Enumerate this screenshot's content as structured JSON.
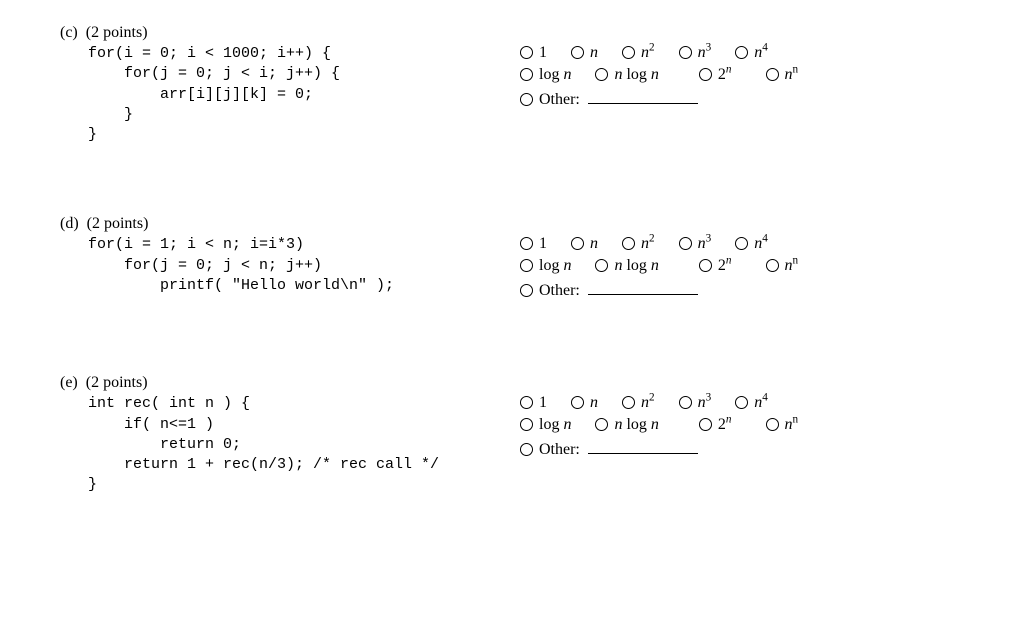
{
  "problems": [
    {
      "letter": "(c)",
      "points": "(2 points)",
      "code": "for(i = 0; i < 1000; i++) {\n    for(j = 0; j < i; j++) {\n        arr[i][j][k] = 0;\n    }\n}"
    },
    {
      "letter": "(d)",
      "points": "(2 points)",
      "code": "for(i = 1; i < n; i=i*3)\n    for(j = 0; j < n; j++)\n        printf( \"Hello world\\n\" );"
    },
    {
      "letter": "(e)",
      "points": "(2 points)",
      "code": "int rec( int n ) {\n    if( n<=1 )\n        return 0;\n    return 1 + rec(n/3); /* rec call */\n}"
    }
  ],
  "options": {
    "row1": [
      "1",
      "n",
      "n²",
      "n³",
      "n⁴"
    ],
    "row2_a": "log n",
    "row2_b": "n log n",
    "row2_c": "2ⁿ",
    "row2_d": "nⁿ",
    "row3_other": "Other:"
  }
}
